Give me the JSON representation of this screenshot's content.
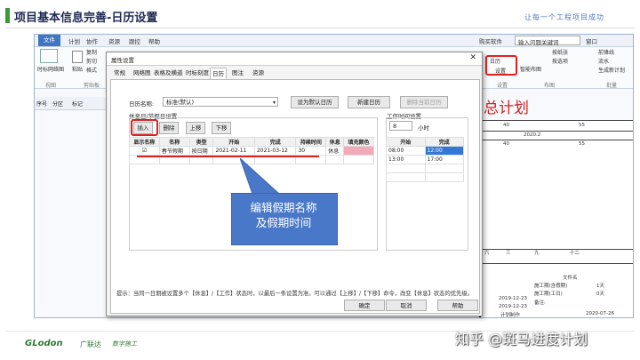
{
  "slide": {
    "title": "项目基本信息完善-日历设置",
    "slogan": "让每一个工程项目成功"
  },
  "menu": [
    "文件",
    "计划",
    "协作",
    "资源",
    "跟控",
    "帮助"
  ],
  "ribbon": {
    "buttons": [
      "复制",
      "剪切",
      "格式",
      "粘贴",
      "时标网络图"
    ],
    "groups": [
      "视图",
      "剪贴板",
      "设置",
      "布图",
      "批量"
    ],
    "buy": "购买软件",
    "search_placeholder": "输入问题关键词",
    "window_menu": "窗口",
    "calendar": "日历",
    "setting": "设置",
    "smart_layout": "智能布图",
    "right_items": [
      "按纸张",
      "按选项",
      "前锋线",
      "流水",
      "生成新计划"
    ]
  },
  "grid_headers": [
    "序号",
    "分区",
    "标记"
  ],
  "gantt": {
    "big_title": "总计划",
    "cells": [
      "40",
      "55",
      "2020.2",
      "40",
      "55",
      "六",
      "三",
      "九",
      "十二",
      "文件名",
      "施工期(含假期)",
      "1天",
      "施工期(工日)",
      "0天",
      "备注:",
      "2019-12-23",
      "2019-12-23",
      "计划制作",
      "2020-07-26"
    ]
  },
  "dialog": {
    "title": "属性设置",
    "close_icon": "close-icon",
    "tabs": [
      "常规",
      "网络图",
      "表格及横道",
      "时标刻度",
      "日历",
      "图注",
      "资源"
    ],
    "selected_tab": "日历",
    "calendar_name_label": "日历名称:",
    "calendar_name_value": "标准(默认)",
    "set_default": "设为默认日历",
    "new_calendar": "新建日历",
    "delete_calendar": "删除当前日历",
    "holiday_section": "休息日/节假日设置",
    "insert": "插入",
    "remove": "删除",
    "up": "上移",
    "down": "下移",
    "table_headers": [
      "显示名称",
      "名称",
      "类型",
      "开始",
      "完成",
      "持续时间",
      "休息",
      "填充颜色"
    ],
    "rows": [
      {
        "show": "☑",
        "name": "春节假期",
        "type": "按日期",
        "start": "2021-02-11",
        "end": "2021-03-12",
        "duration": "30",
        "rest": "休息"
      }
    ],
    "worktime_section": "工作时间设置",
    "hours_value": "8",
    "hours_unit": "小时",
    "worktime_headers": [
      "开始",
      "完成"
    ],
    "worktime_rows": [
      {
        "start": "08:00",
        "end": "12:00"
      },
      {
        "start": "13:00",
        "end": "17:00"
      }
    ],
    "hint": "提示：当同一日期被设置多个【休息】/【工作】状态时，以最后一条设置为准。可以通过【上移】/【下移】命令，改变【休息】状态的优先级。",
    "ok": "确定",
    "cancel": "取消",
    "help": "帮助"
  },
  "callout": {
    "line1": "编辑假期名称",
    "line2": "及假期时间"
  },
  "footer": {
    "brand": "GLodon",
    "brand_cn": "广联达",
    "sub": "数字施工",
    "watermark": "知乎 @斑马进度计划"
  }
}
